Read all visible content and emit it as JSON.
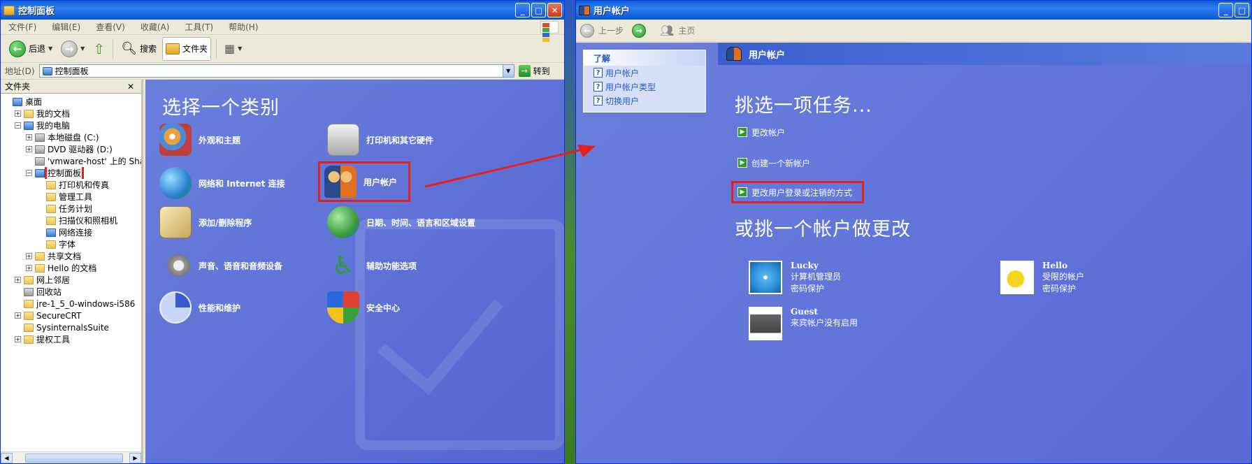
{
  "left_window": {
    "title": "控制面板",
    "menu": [
      "文件(F)",
      "编辑(E)",
      "查看(V)",
      "收藏(A)",
      "工具(T)",
      "帮助(H)"
    ],
    "toolbar": {
      "back": "后退",
      "search": "搜索",
      "folders": "文件夹"
    },
    "address": {
      "label": "地址(D)",
      "value": "控制面板",
      "go": "转到"
    },
    "folders_pane": {
      "title": "文件夹",
      "close": "✕",
      "tree": [
        {
          "label": "桌面",
          "level": 0,
          "pm": ""
        },
        {
          "label": "我的文档",
          "level": 1,
          "pm": "+"
        },
        {
          "label": "我的电脑",
          "level": 1,
          "pm": "−"
        },
        {
          "label": "本地磁盘 (C:)",
          "level": 2,
          "pm": "+"
        },
        {
          "label": "DVD 驱动器 (D:)",
          "level": 2,
          "pm": "+"
        },
        {
          "label": "'vmware-host' 上的 Shar",
          "level": 2,
          "pm": ""
        },
        {
          "label": "控制面板",
          "level": 2,
          "pm": "−"
        },
        {
          "label": "打印机和传真",
          "level": 3,
          "pm": ""
        },
        {
          "label": "管理工具",
          "level": 3,
          "pm": ""
        },
        {
          "label": "任务计划",
          "level": 3,
          "pm": ""
        },
        {
          "label": "扫描仪和照相机",
          "level": 3,
          "pm": ""
        },
        {
          "label": "网络连接",
          "level": 3,
          "pm": ""
        },
        {
          "label": "字体",
          "level": 3,
          "pm": ""
        },
        {
          "label": "共享文档",
          "level": 2,
          "pm": "+"
        },
        {
          "label": "Hello 的文档",
          "level": 2,
          "pm": "+"
        },
        {
          "label": "网上邻居",
          "level": 1,
          "pm": "+"
        },
        {
          "label": "回收站",
          "level": 1,
          "pm": ""
        },
        {
          "label": "jre-1_5_0-windows-i586",
          "level": 1,
          "pm": ""
        },
        {
          "label": "SecureCRT",
          "level": 1,
          "pm": "+"
        },
        {
          "label": "SysinternalsSuite",
          "level": 1,
          "pm": ""
        },
        {
          "label": "提权工具",
          "level": 1,
          "pm": "+"
        }
      ]
    },
    "heading": "选择一个类别",
    "categories": [
      {
        "label": "外观和主题",
        "color": "#e8a040"
      },
      {
        "label": "打印机和其它硬件",
        "color": "#d0d0d0"
      },
      {
        "label": "网络和 Internet 连接",
        "color": "#3aa0e0"
      },
      {
        "label": "用户帐户",
        "color": "#e07020"
      },
      {
        "label": "添加/删除程序",
        "color": "#e6d090"
      },
      {
        "label": "日期、时间、语言和区域设置",
        "color": "#4aa04a"
      },
      {
        "label": "声音、语音和音频设备",
        "color": "#c0c0c0"
      },
      {
        "label": "辅助功能选项",
        "color": "#2aa02a"
      },
      {
        "label": "性能和维护",
        "color": "#b0c0e8"
      },
      {
        "label": "安全中心",
        "color": "#3060c0"
      }
    ]
  },
  "right_window": {
    "title": "用户帐户",
    "toolbar": {
      "back": "上一步",
      "home": "主页"
    },
    "sidebar": {
      "title": "了解",
      "items": [
        "用户帐户",
        "用户帐户类型",
        "切换用户"
      ]
    },
    "header": "用户帐户",
    "task_heading": "挑选一项任务...",
    "tasks": [
      "更改帐户",
      "创建一个新帐户",
      "更改用户登录或注销的方式"
    ],
    "account_heading": "或挑一个帐户做更改",
    "accounts": [
      {
        "name": "Lucky",
        "line1": "计算机管理员",
        "line2": "密码保护",
        "color": "#2a8fd8"
      },
      {
        "name": "Hello",
        "line1": "受限的帐户",
        "line2": "密码保护",
        "color": "#f0d020"
      },
      {
        "name": "Guest",
        "line1": "来宾帐户没有启用",
        "line2": "",
        "color": "#555555"
      }
    ]
  },
  "colors": {
    "highlight": "#e8201c",
    "pane_blue": "#6a7fdd",
    "arrow": "#e8201c"
  }
}
